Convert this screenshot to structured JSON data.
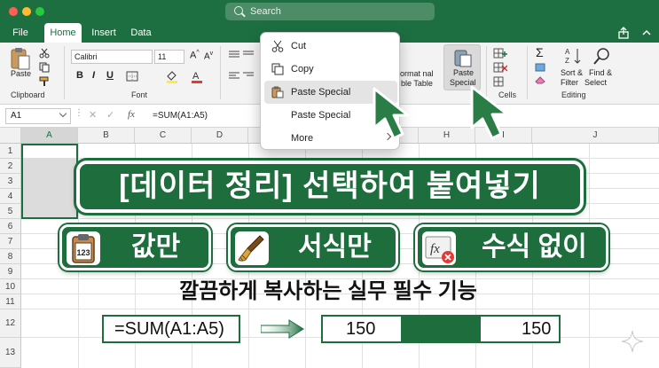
{
  "window": {
    "search_placeholder": "Search"
  },
  "tabs": [
    {
      "label": "File"
    },
    {
      "label": "Home"
    },
    {
      "label": "Insert"
    },
    {
      "label": "Data"
    }
  ],
  "ribbon": {
    "clipboard": {
      "paste_label": "Paste",
      "group_label": "Clipboard"
    },
    "font": {
      "family": "Calibri",
      "size": "11",
      "group_label": "Font",
      "bold": "B",
      "italic": "I",
      "underline": "U"
    },
    "format_table": {
      "line1": "ormat nal",
      "line2": "ble Table"
    },
    "paste_special": {
      "line1": "Paste",
      "line2": "Special"
    },
    "cells_group_label": "Cells",
    "editing": {
      "sort": {
        "line1": "Sort &",
        "line2": "Filter"
      },
      "find": {
        "line1": "Find &",
        "line2": "Select"
      },
      "group_label": "Editing"
    }
  },
  "formula_bar": {
    "name_box": "A1",
    "formula": "=SUM(A1:A5)",
    "fx": "fx"
  },
  "grid": {
    "columns": [
      "A",
      "B",
      "C",
      "D",
      "E",
      "F",
      "G",
      "H",
      "I",
      "J"
    ],
    "rows": [
      "1",
      "2",
      "3",
      "4",
      "5",
      "6",
      "7",
      "8",
      "9",
      "10",
      "11",
      "12",
      "13"
    ]
  },
  "context_menu": {
    "items": [
      {
        "label": "Cut",
        "icon": "scissors-icon"
      },
      {
        "label": "Copy",
        "icon": "copy-icon"
      },
      {
        "label": "Paste Special",
        "icon": "paste-icon"
      },
      {
        "label": "Paste Special",
        "icon": ""
      },
      {
        "label": "More",
        "icon": ""
      }
    ]
  },
  "overlay": {
    "title": "[데이터 정리] 선택하여 붙여넣기",
    "chips": [
      {
        "label": "값만",
        "icon": "clipboard-123-icon"
      },
      {
        "label": "서식만",
        "icon": "paintbrush-icon"
      },
      {
        "label": "수식 없이",
        "icon": "fx-remove-icon"
      }
    ],
    "chip1_icon_text": "123",
    "chip3_icon_text": "fx",
    "subtitle": "깔끔하게 복사하는 실무 필수 기능",
    "example_formula": "=SUM(A1:A5)",
    "example_value_left": "150",
    "example_value_right": "150"
  },
  "colors": {
    "brand_green": "#1d6f42",
    "banner_green": "#1e6e3d"
  }
}
